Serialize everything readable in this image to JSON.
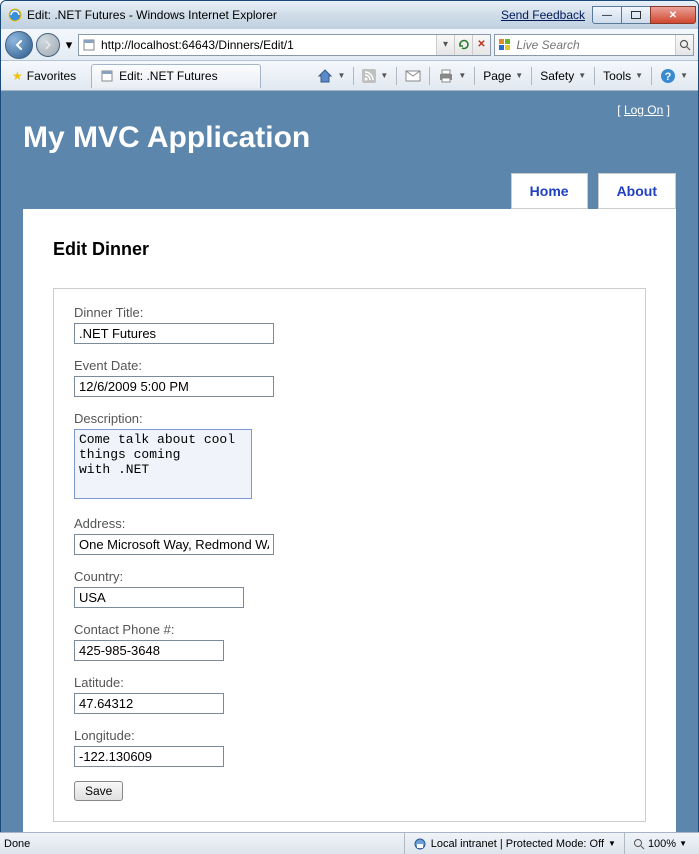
{
  "window": {
    "title": "Edit: .NET Futures - Windows Internet Explorer",
    "send_feedback": "Send Feedback"
  },
  "nav": {
    "url": "http://localhost:64643/Dinners/Edit/1",
    "search_placeholder": "Live Search"
  },
  "cmdbar": {
    "favorites": "Favorites",
    "tab_title": "Edit: .NET Futures",
    "page": "Page",
    "safety": "Safety",
    "tools": "Tools"
  },
  "page": {
    "logon": "Log On",
    "app_title": "My MVC Application",
    "nav_home": "Home",
    "nav_about": "About",
    "heading": "Edit Dinner",
    "labels": {
      "title": "Dinner Title:",
      "date": "Event Date:",
      "desc": "Description:",
      "address": "Address:",
      "country": "Country:",
      "phone": "Contact Phone #:",
      "lat": "Latitude:",
      "lon": "Longitude:"
    },
    "values": {
      "title": ".NET Futures",
      "date": "12/6/2009 5:00 PM",
      "desc": "Come talk about cool things coming\nwith .NET",
      "address": "One Microsoft Way, Redmond WA",
      "country": "USA",
      "phone": "425-985-3648",
      "lat": "47.64312",
      "lon": "-122.130609"
    },
    "save": "Save"
  },
  "status": {
    "left": "Done",
    "zone": "Local intranet | Protected Mode: Off",
    "zoom": "100%"
  }
}
